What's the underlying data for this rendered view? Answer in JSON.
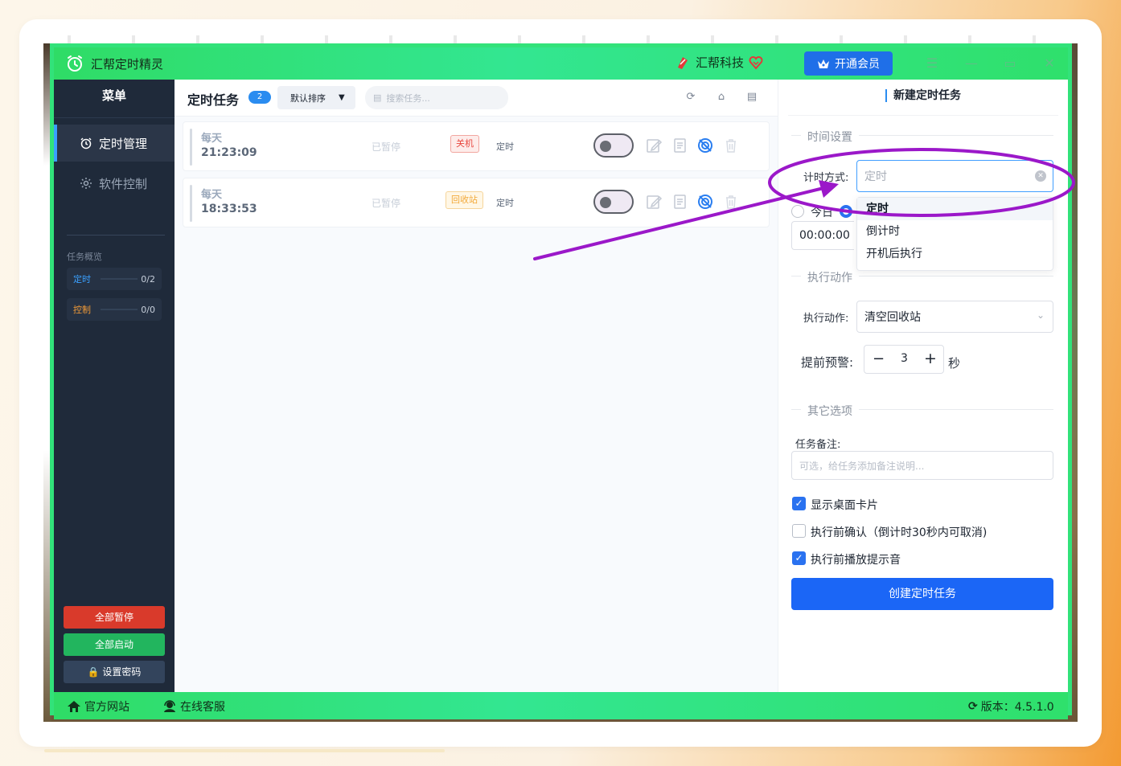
{
  "app": {
    "title": "汇帮定时精灵",
    "brand": "汇帮科技",
    "vip_label": "开通会员"
  },
  "sidebar": {
    "header": "菜单",
    "items": [
      {
        "label": "定时管理",
        "icon": "alarm-clock-icon",
        "active": true
      },
      {
        "label": "软件控制",
        "icon": "gear-icon",
        "active": false
      }
    ],
    "overview_title": "任务概览",
    "stats": [
      {
        "label": "定时",
        "value": "0/2",
        "color": "#3aa0ff"
      },
      {
        "label": "控制",
        "value": "0/0",
        "color": "#f29b38"
      }
    ],
    "pause_all": "全部暂停",
    "start_all": "全部启动",
    "set_password": "设置密码"
  },
  "tasks": {
    "title": "定时任务",
    "count": "2",
    "sort_label": "默认排序",
    "search_placeholder": "搜索任务...",
    "rows": [
      {
        "day": "每天",
        "time": "21:23:09",
        "status": "已暂停",
        "tag": "关机",
        "tag_color": "#e8453c",
        "type": "定时"
      },
      {
        "day": "每天",
        "time": "18:33:53",
        "status": "已暂停",
        "tag": "回收站",
        "tag_color": "#f2a93b",
        "type": "定时"
      }
    ]
  },
  "form": {
    "title": "新建定时任务",
    "time_section": "时间设置",
    "timing_mode_label": "计时方式:",
    "timing_mode_value": "定时",
    "timing_options": [
      "定时",
      "倒计时",
      "开机后执行"
    ],
    "today_label": "今日",
    "time_value": "00:00:00",
    "action_section": "执行动作",
    "action_label": "执行动作:",
    "action_value": "清空回收站",
    "warn_label": "提前预警:",
    "warn_value": "3",
    "warn_unit": "秒",
    "other_section": "其它选项",
    "note_label": "任务备注:",
    "note_placeholder": "可选，给任务添加备注说明...",
    "options": [
      {
        "label": "显示桌面卡片",
        "checked": true
      },
      {
        "label": "执行前确认（倒计时30秒内可取消)",
        "checked": false
      },
      {
        "label": "执行前播放提示音",
        "checked": true
      }
    ],
    "create_label": "创建定时任务"
  },
  "footer": {
    "website": "官方网站",
    "support": "在线客服",
    "version": "版本：4.5.1.0"
  },
  "colors": {
    "titlebar_green": "#2fdc66",
    "sidebar_bg": "#1f2a3a",
    "primary_blue": "#1b66f6",
    "annotation_purple": "#9b18c9"
  }
}
